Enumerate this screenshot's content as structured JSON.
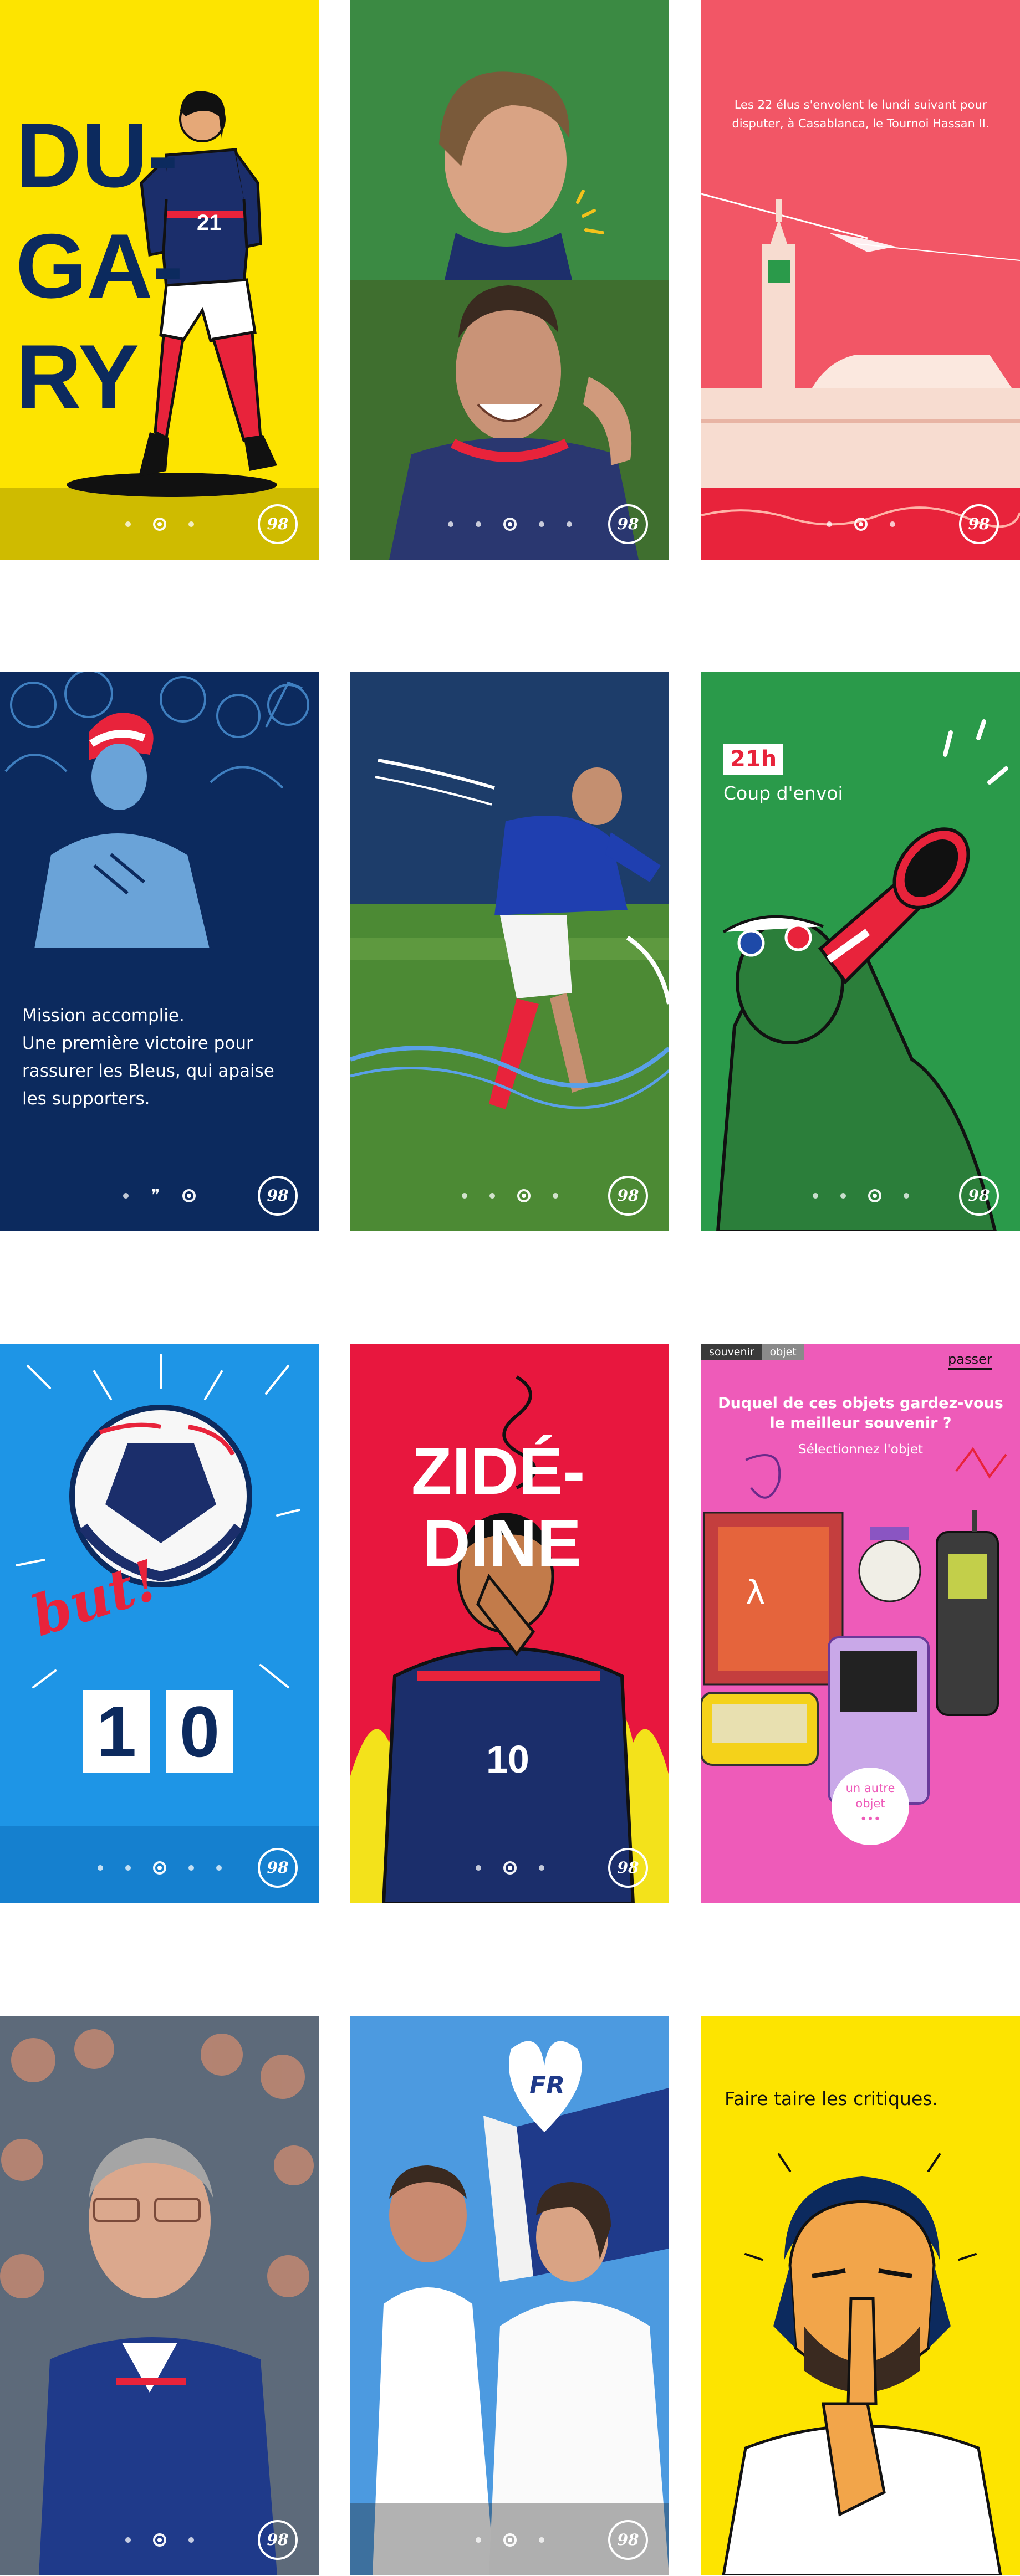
{
  "colors": {
    "yellow": "#fde400",
    "navy": "#0c2a5e",
    "red": "#e8233b",
    "coral": "#f25666",
    "green": "#2a9a4a",
    "blue": "#1e95e6",
    "pink": "#ee5bb9"
  },
  "badge": "98",
  "card1": {
    "word_line1": "DU-",
    "word_line2": "GA-",
    "word_line3": "RY",
    "jersey": "21"
  },
  "card3": {
    "text": "Les 22 élus s'envolent le lundi suivant pour disputer, à Casablanca, le Tournoi Hassan II."
  },
  "card4": {
    "line1": "Mission accomplie.",
    "line2": "Une première victoire pour",
    "line3": "rassurer les Bleus, qui apaise",
    "line4": "les supporters.",
    "quote_mark": "❞"
  },
  "card6": {
    "time": "21h",
    "caption": "Coup d'envoi"
  },
  "card7": {
    "but": "but!",
    "digit1": "1",
    "digit2": "0"
  },
  "card8": {
    "word_line1": "ZIDÉ-",
    "word_line2": "DINE",
    "jersey": "10"
  },
  "card9": {
    "tab1": "souvenir",
    "tab2": "objet",
    "skip": "passer",
    "question": "Duquel de ces objets gardez-vous le meilleur souvenir ?",
    "instruction": "Sélectionnez l'objet",
    "other1": "un autre",
    "other2": "objet",
    "other3": "•••"
  },
  "card11": {
    "heart_label": "FR"
  },
  "card12": {
    "text": "Faire taire les critiques."
  }
}
